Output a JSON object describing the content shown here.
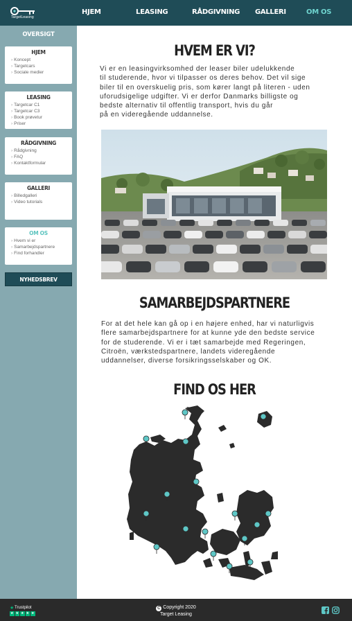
{
  "brand": {
    "logo_text": "TargetLeasing"
  },
  "nav": {
    "items": [
      {
        "label": "HJEM",
        "active": false
      },
      {
        "label": "LEASING",
        "active": false
      },
      {
        "label": "RÅDGIVNING",
        "active": false
      },
      {
        "label": "GALLERI",
        "active": false
      },
      {
        "label": "OM OS",
        "active": true
      }
    ]
  },
  "sidebar": {
    "title": "OVERSIGT",
    "sections": [
      {
        "title": "HJEM",
        "items": [
          "Koncept",
          "Targetcars",
          "Sociale medier"
        ]
      },
      {
        "title": "LEASING",
        "items": [
          "Targetcar C1",
          "Targetcar C3",
          "Book prøvetur",
          "Priser"
        ]
      },
      {
        "title": "RÅDGIVNING",
        "items": [
          "Rådgivning",
          "FAQ",
          "Kontaktformular"
        ]
      },
      {
        "title": "GALLERI",
        "items": [
          "Billedgalleri",
          "Video tutorials"
        ]
      },
      {
        "title": "OM OS",
        "items": [
          "Hvem vi er",
          "Samarbejdspartnere",
          "Find forhandler"
        ]
      }
    ],
    "newsletter_label": "NYHEDSBREV"
  },
  "main": {
    "section1": {
      "heading": "HVEM ER VI?",
      "lines": [
        "Vi er en leasingvirksomhed der leaser biler udelukkende",
        "til studerende, hvor vi tilpasser os deres behov. Det vil sige",
        "biler til en overskuelig pris, som kører langt på literen - uden",
        "uforudsigelige udgifter. Vi er derfor Danmarks billigste og",
        "bedste alternativ til offentlig transport, hvis du går",
        "på en videregående uddannelse."
      ]
    },
    "section2": {
      "heading": "SAMARBEJDSPARTNERE",
      "lines": [
        "For at det hele kan gå op i en højere enhed, har vi naturligvis",
        "flere samarbejdspartnere for at kunne yde den bedste service",
        "for de studerende. Vi er i tæt samarbejde med Regeringen,",
        "Citroën, værkstedspartnere, landets videregående",
        "uddannelser, diverse forsikringsselskaber og OK."
      ]
    },
    "section3": {
      "heading": "FIND OS HER"
    }
  },
  "footer": {
    "trustpilot_label": "Trustpilot",
    "copyright_line1": "Copyright 2020",
    "copyright_line2": "Target Leasing",
    "copyright_symbol": "C"
  },
  "colors": {
    "nav_bg": "#1f4c57",
    "accent": "#6fd4cf",
    "sidebar_bg": "#86a9b0",
    "footer_bg": "#2a2a2a",
    "map_land": "#2b2b2b",
    "map_pin": "#5ec7c6"
  },
  "icons": [
    "key-logo-icon",
    "trustpilot-star-icon",
    "facebook-icon",
    "instagram-icon",
    "copyright-icon",
    "map-pin-icon"
  ]
}
